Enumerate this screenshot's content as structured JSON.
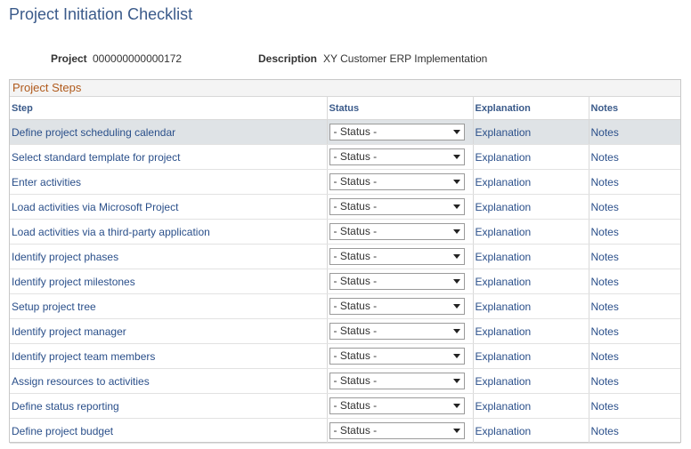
{
  "page": {
    "title": "Project Initiation Checklist"
  },
  "header": {
    "project_label": "Project",
    "project_value": "000000000000172",
    "description_label": "Description",
    "description_value": "XY Customer ERP Implementation"
  },
  "grid": {
    "caption": "Project Steps",
    "columns": [
      "Step",
      "Status",
      "Explanation",
      "Notes"
    ],
    "status_placeholder": "- Status -",
    "explanation_link": "Explanation",
    "notes_link": "Notes",
    "rows": [
      "Define project scheduling calendar",
      "Select standard template for project",
      "Enter activities",
      "Load activities via Microsoft Project",
      "Load activities via a third-party application",
      "Identify project phases",
      "Identify project milestones",
      "Setup project tree",
      "Identify project manager",
      "Identify project team members",
      "Assign resources to activities",
      "Define status reporting",
      "Define project budget"
    ]
  },
  "colors": {
    "title": "#3a5a8a",
    "caption": "#b05a1c",
    "link": "#2a4f8a",
    "highlight_row": "#dfe3e6"
  }
}
